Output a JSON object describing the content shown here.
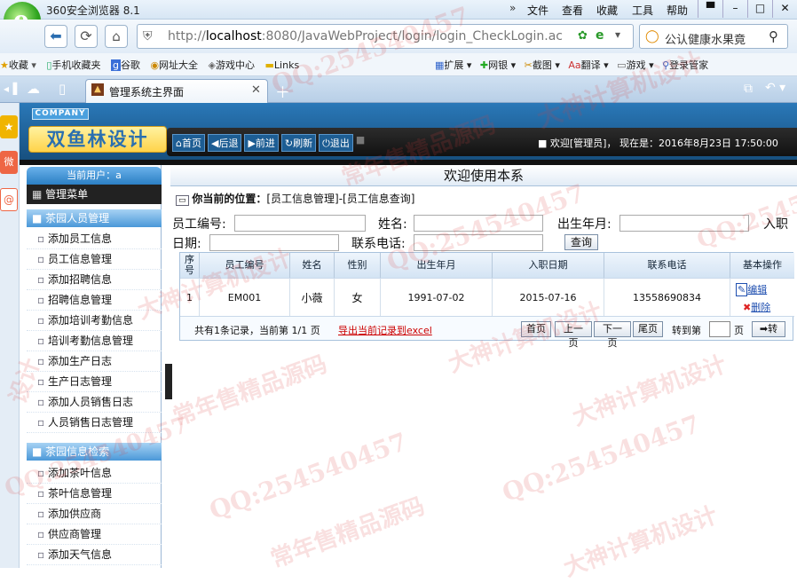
{
  "browser": {
    "title": "360安全浏览器 8.1",
    "menu": [
      "文件",
      "查看",
      "收藏",
      "工具",
      "帮助"
    ],
    "url": "http://localhost:8080/JavaWebProject/login/login_CheckLogin.ac",
    "url_host": "localhost",
    "url_prefix": "http://",
    "url_rest": ":8080/JavaWebProject/login/login_CheckLogin.ac",
    "search_text": "公认健康水果竟",
    "bookmarks": [
      "收藏",
      "手机收藏夹",
      "谷歌",
      "网址大全",
      "游戏中心",
      "Links"
    ],
    "bookmarks_right": [
      "扩展",
      "网银",
      "截图",
      "翻译",
      "游戏",
      "登录管家"
    ],
    "tab_title": "管理系统主界面"
  },
  "header": {
    "company": "COMPANY",
    "logo": "双鱼林设计",
    "nav": [
      "首页",
      "后退",
      "前进",
      "刷新",
      "退出"
    ],
    "welcome": "欢迎[管理员]",
    "time_label": "现在是：",
    "time_value": "2016年8月23日 17:50:00"
  },
  "sidebar": {
    "current_user_label": "当前用户：a",
    "menu_title": "管理菜单",
    "sections": [
      {
        "title": "茶园人员管理",
        "items": [
          "添加员工信息",
          "员工信息管理",
          "添加招聘信息",
          "招聘信息管理",
          "添加培训考勤信息",
          "培训考勤信息管理",
          "添加生产日志",
          "生产日志管理",
          "添加人员销售日志",
          "人员销售日志管理"
        ]
      },
      {
        "title": "茶园信息检索",
        "items": [
          "添加茶叶信息",
          "茶叶信息管理",
          "添加供应商",
          "供应商管理",
          "添加天气信息"
        ]
      }
    ]
  },
  "main": {
    "welcome_title": "欢迎使用本系",
    "location_label": "你当前的位置：",
    "location_path": "[员工信息管理]-[员工信息查询]",
    "search": {
      "emp_no_label": "员工编号:",
      "name_label": "姓名:",
      "birth_label": "出生年月:",
      "join_label_a": "入职",
      "join_label_b": "日期:",
      "phone_label": "联系电话:",
      "query_button": "查询"
    },
    "table": {
      "columns": [
        "序号",
        "员工编号",
        "姓名",
        "性别",
        "出生年月",
        "入职日期",
        "联系电话",
        "基本操作"
      ],
      "rows": [
        {
          "seq": "1",
          "emp_no": "EM001",
          "name": "小薇",
          "gender": "女",
          "birth": "1991-07-02",
          "join": "2015-07-16",
          "phone": "13558690834",
          "edit": "编辑",
          "del": "删除"
        }
      ]
    },
    "pager": {
      "summary": "共有1条记录，当前第 1/1 页",
      "export": "导出当前记录到excel",
      "first": "首页",
      "prev": "上一页",
      "next": "下一页",
      "last": "尾页",
      "goto_label": "转到第",
      "page_unit": "页",
      "go": "转"
    }
  },
  "watermarks": [
    "QQ:254540457",
    "大神计算机设计",
    "常年售精品源码",
    "QQ:254540457",
    "大神计算机设计",
    "QQ:254540457",
    "常年售精品源码",
    "大神计算机设计",
    "QQ:254540457",
    "大神计算机设计",
    "QQ:254540457",
    "常年售精品源码",
    "QQ:254540457",
    "大神计算机设计",
    "设计"
  ],
  "colors": {
    "accent": "#1f6fb0",
    "header_bg": "#1d5d93",
    "section": "#3d87c7"
  }
}
